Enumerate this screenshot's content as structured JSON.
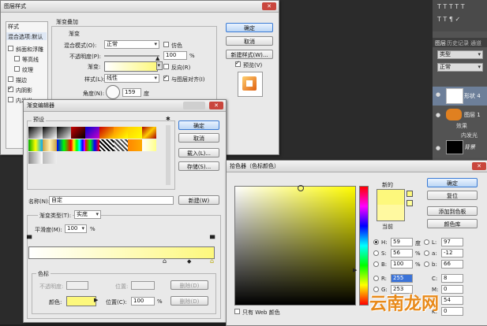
{
  "layer_style": {
    "title": "图层样式",
    "styles_header": "样式",
    "blend_default": "混合选项:默认",
    "side_items": [
      {
        "label": "斜面和浮雕",
        "checked": false
      },
      {
        "label": "等高线",
        "checked": false
      },
      {
        "label": "纹理",
        "checked": false
      },
      {
        "label": "描边",
        "checked": false
      },
      {
        "label": "内阴影",
        "checked": true
      },
      {
        "label": "内发光",
        "checked": false
      }
    ],
    "section_title": "渐变叠加",
    "sub_title": "渐变",
    "blend_mode_label": "混合模式(O):",
    "blend_mode_value": "正常",
    "dither_label": "仿色",
    "opacity_label": "不透明度(P):",
    "opacity_value": "100",
    "percent": "%",
    "gradient_label": "渐变:",
    "reverse_label": "反向(R)",
    "style_label": "样式(L):",
    "style_value": "线性",
    "align_label": "与图层对齐(I)",
    "angle_label": "角度(N):",
    "angle_value": "159",
    "angle_unit": "度",
    "ok": "确定",
    "cancel": "取消",
    "new_style": "新建样式(W)...",
    "preview": "预览(V)"
  },
  "gradient_editor": {
    "title": "渐变编辑器",
    "presets_label": "预设",
    "ok": "确定",
    "cancel": "取消",
    "load": "载入(L)...",
    "save": "存储(S)...",
    "name_label": "名称(N):",
    "name_value": "自定",
    "new_button": "新建(W)",
    "type_label": "渐变类型(T):",
    "type_value": "实底",
    "smooth_label": "平滑度(M):",
    "smooth_value": "100",
    "percent": "%",
    "stops_label": "色标",
    "stop_opacity_label": "不透明度:",
    "location_label": "位置:",
    "delete_label": "删除(D)",
    "color_label": "颜色:",
    "location2_label": "位置(C):",
    "location2_value": "100",
    "gradient_start": "#ffffff",
    "gradient_end": "#fdf87c"
  },
  "color_picker": {
    "title": "拾色器（色标颜色）",
    "new_label": "新的",
    "current_label": "当前",
    "new_color": "#fdf87c",
    "current_color": "#fff9a0",
    "ok": "确定",
    "reset": "复位",
    "add_swatch": "添加到色板",
    "libraries": "颜色库",
    "web_only": "只有 Web 颜色",
    "fields": {
      "H": "59",
      "H_unit": "度",
      "S": "56",
      "S_unit": "%",
      "B": "100",
      "B_unit": "%",
      "R": "255",
      "G": "253",
      "Bv": "",
      "L": "97",
      "a": "-12",
      "b": "66",
      "C": "8",
      "M": "0",
      "Y": "54",
      "K": "0"
    }
  },
  "right_panel": {
    "tabs": [
      "图层",
      "历史记录",
      "通道"
    ],
    "kind": "类型",
    "blend": "正常",
    "layers": [
      {
        "name": "形状 4"
      },
      {
        "name": "图层 1"
      },
      {
        "name": "效果"
      },
      {
        "name": "内发光"
      },
      {
        "name": "背景"
      }
    ],
    "top_label": "图层"
  },
  "watermark": "云南龙网"
}
